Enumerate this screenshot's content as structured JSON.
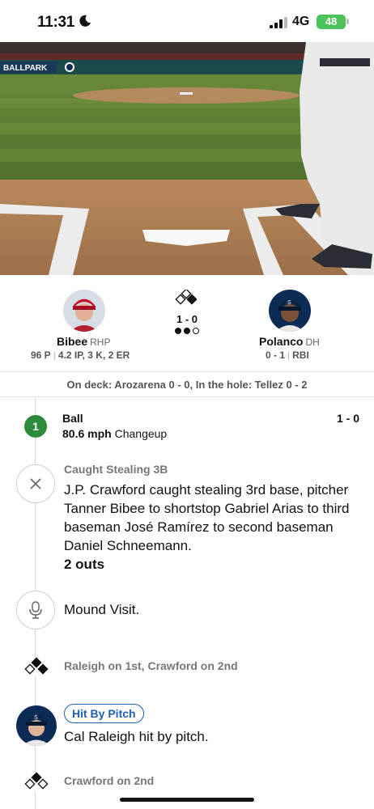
{
  "status_bar": {
    "time": "11:31",
    "network": "4G",
    "battery": "48"
  },
  "video": {
    "stadium_sign": "BALLPARK"
  },
  "matchup": {
    "pitcher": {
      "name": "Bibee",
      "position": "RHP",
      "pitches": "96 P",
      "line": "4.2 IP, 3 K, 2 ER"
    },
    "count": "1 - 0",
    "batter": {
      "name": "Polanco",
      "position": "DH",
      "line": "0 - 1",
      "extra": "RBI"
    }
  },
  "on_deck": "On deck: Arozarena 0 - 0, In the hole: Tellez 0 - 2",
  "feed": {
    "pitch": {
      "number": "1",
      "result": "Ball",
      "speed": "80.6 mph",
      "type": "Changeup",
      "count": "1 - 0"
    },
    "caught_stealing": {
      "label": "Caught Stealing 3B",
      "text": "J.P. Crawford caught stealing 3rd base, pitcher Tanner Bibee to shortstop Gabriel Arias to third baseman José Ramírez to second baseman Daniel Schneemann.",
      "outs": "2 outs"
    },
    "mound_visit": {
      "text": "Mound Visit."
    },
    "runners_1": "Raleigh on 1st, Crawford on 2nd",
    "hbp": {
      "badge": "Hit By Pitch",
      "text": "Cal Raleigh hit by pitch."
    },
    "runners_2": "Crawford on 2nd"
  },
  "colors": {
    "pitch_ball": "#2e8b3a",
    "badge_blue": "#1f5fb4",
    "battery": "#4cc25a"
  }
}
